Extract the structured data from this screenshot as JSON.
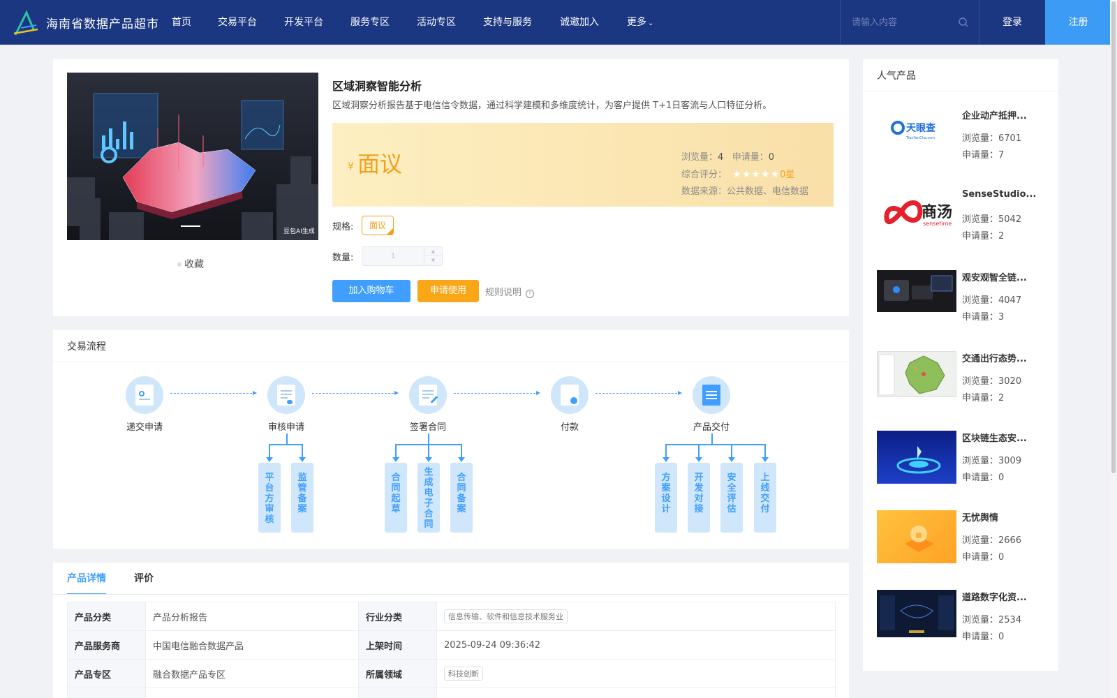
{
  "header": {
    "brand": "海南省数据产品超市",
    "nav": [
      "首页",
      "交易平台",
      "开发平台",
      "服务专区",
      "活动专区",
      "支持与服务",
      "诚邀加入",
      "更多"
    ],
    "search_placeholder": "请输入内容",
    "login": "登录",
    "register": "注册"
  },
  "product": {
    "name": "区域洞察智能分析",
    "description": "区域洞察分析报告基于电信信令数据，通过科学建模和多维度统计，为客户提供 T+1日客流与人口特征分析。",
    "image_caption": "豆包AI生成",
    "collect": "收藏",
    "price_symbol": "¥",
    "price": "面议",
    "views_label": "浏览量：",
    "views": "4",
    "applies_label": "申请量：",
    "applies": "0",
    "rating_label": "综合评分：",
    "rating": "0星",
    "rating_stars": 0,
    "source_label": "数据来源：",
    "source": "公共数据、电信数据",
    "spec_label": "规格:",
    "spec_value": "面议",
    "qty_label": "数量:",
    "qty_value": "1",
    "btn_cart": "加入购物车",
    "btn_apply": "申请使用",
    "rules": "规则说明"
  },
  "flow": {
    "title": "交易流程",
    "steps": [
      "递交申请",
      "审核申请",
      "签署合同",
      "付款",
      "产品交付"
    ],
    "sub_review": [
      "平台方审核",
      "监管备案"
    ],
    "sub_contract": [
      "合同起草",
      "生成电子合同",
      "合同备案"
    ],
    "sub_delivery": [
      "方案设计",
      "开发对接",
      "安全评估",
      "上线交付"
    ]
  },
  "detail": {
    "tabs": [
      "产品详情",
      "评价"
    ],
    "rows": [
      {
        "k1": "产品分类",
        "v1": "产品分析报告",
        "k2": "行业分类",
        "v2": "信息传输、软件和信息技术服务业"
      },
      {
        "k1": "产品服务商",
        "v1": "中国电信融合数据产品",
        "k2": "上架时间",
        "v2": "2025-09-24 09:36:42"
      },
      {
        "k1": "产品专区",
        "v1": "融合数据产品专区",
        "k2": "所属领域",
        "v2": "科技创新"
      }
    ]
  },
  "popular": {
    "title": "人气产品",
    "views_label": "浏览量：",
    "applies_label": "申请量：",
    "items": [
      {
        "name": "企业动产抵押...",
        "views": "6701",
        "applies": "7",
        "logo_text": "天眼查",
        "logo_sub": "TianYanCha.com"
      },
      {
        "name": "SenseStudio...",
        "views": "5042",
        "applies": "2",
        "logo_text": "商汤",
        "logo_sub": "sensetime"
      },
      {
        "name": "观安观智全链...",
        "views": "4047",
        "applies": "3"
      },
      {
        "name": "交通出行态势...",
        "views": "3020",
        "applies": "2"
      },
      {
        "name": "区块链生态安...",
        "views": "3009",
        "applies": "0"
      },
      {
        "name": "无忧舆情",
        "views": "2666",
        "applies": "0"
      },
      {
        "name": "道路数字化资...",
        "views": "2534",
        "applies": "0"
      }
    ]
  },
  "colors": {
    "header": "#1c3782",
    "primary": "#409eff",
    "accent": "#f9a716"
  }
}
